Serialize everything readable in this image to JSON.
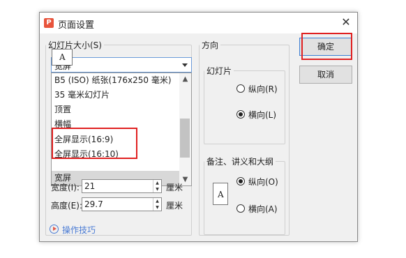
{
  "window": {
    "title": "页面设置",
    "app_icon": "P"
  },
  "slide_size": {
    "legend": "幻灯片大小(S)",
    "selected_value": "宽屏",
    "options": [
      "B5 (ISO) 纸张(176x250 毫米)",
      "35 毫米幻灯片",
      "顶置",
      "横幅",
      "全屏显示(16:9)",
      "全屏显示(16:10)",
      "宽屏"
    ],
    "selected_index": 6,
    "width_label": "宽度(I):",
    "width_value": "21",
    "height_label": "高度(E):",
    "height_value": "29.7",
    "unit": "厘米"
  },
  "orientation": {
    "legend": "方向",
    "slide_group": {
      "legend": "幻灯片",
      "portrait": "纵向(R)",
      "landscape": "横向(L)",
      "selected": "landscape"
    },
    "notes_group": {
      "legend": "备注、讲义和大纲",
      "portrait": "纵向(O)",
      "landscape": "横向(A)",
      "selected": "portrait"
    },
    "page_icon_letter": "A"
  },
  "buttons": {
    "ok": "确定",
    "cancel": "取消"
  },
  "tips_link": "操作技巧",
  "colors": {
    "highlight": "#e02020",
    "link": "#4a7bd4",
    "app_icon": "#e8543c"
  }
}
